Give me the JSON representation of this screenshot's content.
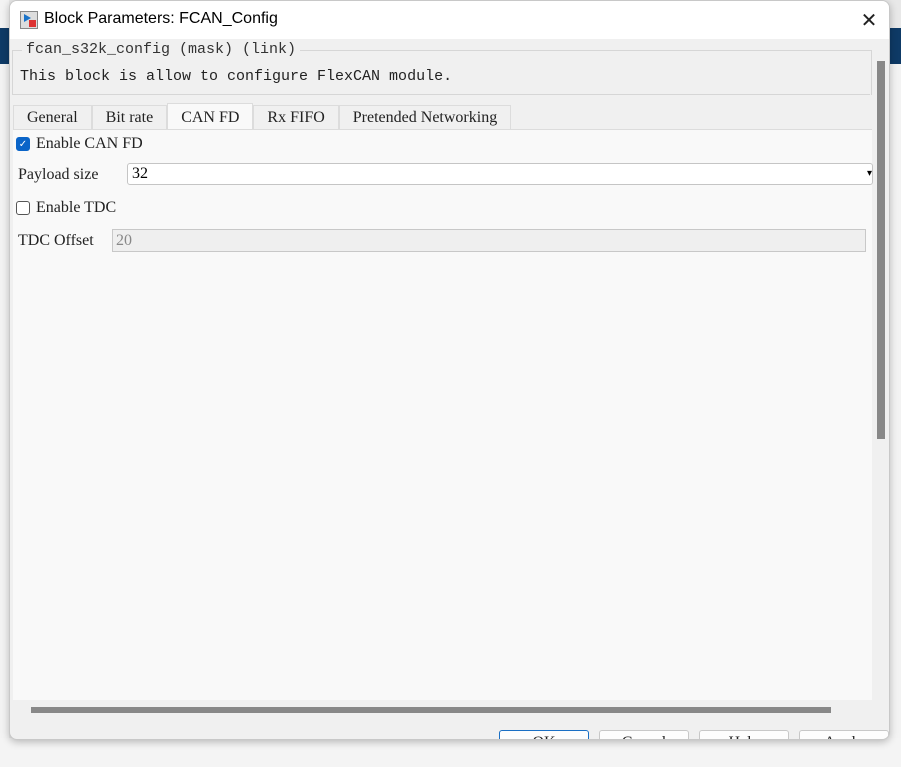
{
  "window": {
    "title": "Block Parameters: FCAN_Config",
    "close_icon": "close-icon"
  },
  "mask": {
    "header": "fcan_s32k_config (mask) (link)",
    "description": "This block is allow to configure FlexCAN module."
  },
  "tabs": [
    {
      "label": "General"
    },
    {
      "label": "Bit rate"
    },
    {
      "label": "CAN FD",
      "active": true
    },
    {
      "label": "Rx FIFO"
    },
    {
      "label": "Pretended Networking"
    }
  ],
  "params": {
    "enable_can_fd": {
      "label": "Enable CAN FD",
      "checked": true
    },
    "payload_size": {
      "label": "Payload size",
      "value": "32"
    },
    "enable_tdc": {
      "label": "Enable TDC",
      "checked": false
    },
    "tdc_offset": {
      "label": "TDC Offset",
      "value": "20",
      "disabled": true
    }
  },
  "buttons": {
    "ok": "OK",
    "cancel": "Cancel",
    "help": "Help",
    "apply": "Apply"
  },
  "colors": {
    "accent": "#0a64c8"
  }
}
